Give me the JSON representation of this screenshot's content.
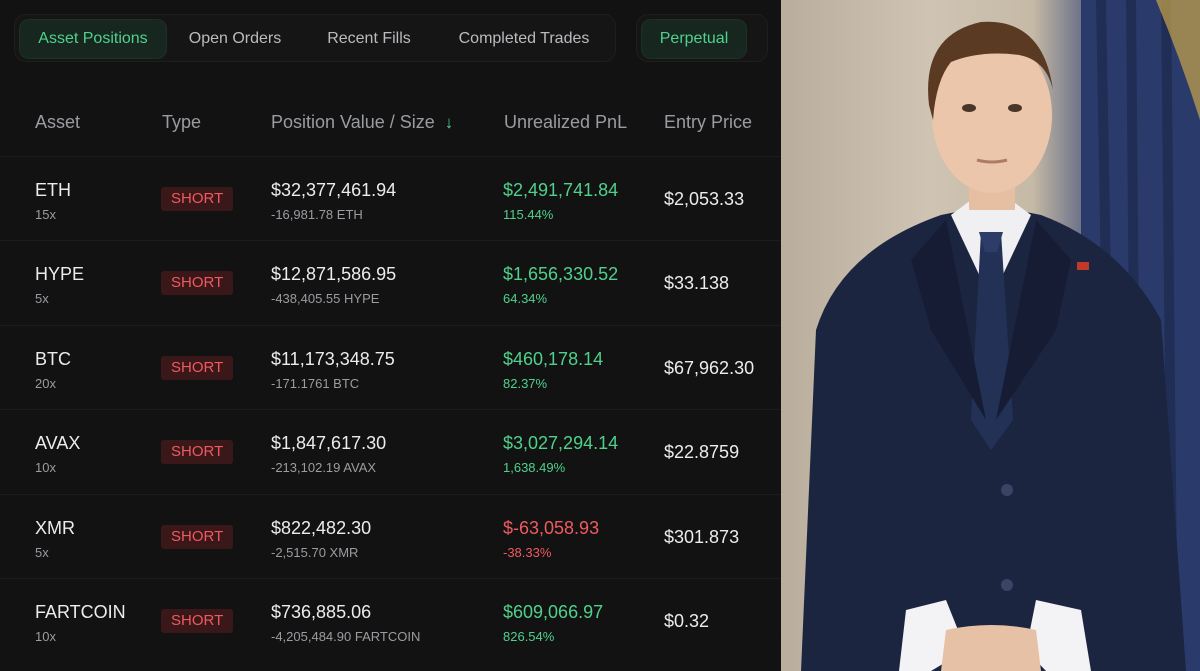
{
  "tabs": [
    {
      "label": "Asset Positions",
      "active": true
    },
    {
      "label": "Open Orders",
      "active": false
    },
    {
      "label": "Recent Fills",
      "active": false
    },
    {
      "label": "Completed Trades",
      "active": false
    }
  ],
  "market_toggle": {
    "label": "Perpetual",
    "active": true
  },
  "table": {
    "headers": {
      "asset": "Asset",
      "type": "Type",
      "position": "Position Value / Size",
      "pnl": "Unrealized PnL",
      "entry": "Entry Price"
    },
    "sort_icon": "arrow-down-icon",
    "rows": [
      {
        "asset": "ETH",
        "leverage": "15x",
        "type": "SHORT",
        "value": "$32,377,461.94",
        "size": "-16,981.78 ETH",
        "pnl": "$2,491,741.84",
        "pnl_pct": "115.44%",
        "pnl_sign": "pos",
        "entry": "$2,053.33"
      },
      {
        "asset": "HYPE",
        "leverage": "5x",
        "type": "SHORT",
        "value": "$12,871,586.95",
        "size": "-438,405.55 HYPE",
        "pnl": "$1,656,330.52",
        "pnl_pct": "64.34%",
        "pnl_sign": "pos",
        "entry": "$33.138"
      },
      {
        "asset": "BTC",
        "leverage": "20x",
        "type": "SHORT",
        "value": "$11,173,348.75",
        "size": "-171.1761 BTC",
        "pnl": "$460,178.14",
        "pnl_pct": "82.37%",
        "pnl_sign": "pos",
        "entry": "$67,962.30"
      },
      {
        "asset": "AVAX",
        "leverage": "10x",
        "type": "SHORT",
        "value": "$1,847,617.30",
        "size": "-213,102.19 AVAX",
        "pnl": "$3,027,294.14",
        "pnl_pct": "1,638.49%",
        "pnl_sign": "pos",
        "entry": "$22.8759"
      },
      {
        "asset": "XMR",
        "leverage": "5x",
        "type": "SHORT",
        "value": "$822,482.30",
        "size": "-2,515.70 XMR",
        "pnl": "$-63,058.93",
        "pnl_pct": "-38.33%",
        "pnl_sign": "neg",
        "entry": "$301.873"
      },
      {
        "asset": "FARTCOIN",
        "leverage": "10x",
        "type": "SHORT",
        "value": "$736,885.06",
        "size": "-4,205,484.90 FARTCOIN",
        "pnl": "$609,066.97",
        "pnl_pct": "826.54%",
        "pnl_sign": "pos",
        "entry": "$0.32"
      }
    ]
  },
  "colors": {
    "background": "#121212",
    "accent_green": "#4fd18c",
    "negative_red": "#ef5a5f",
    "short_badge_bg": "#3a1719",
    "muted_text": "#9a9ca1"
  },
  "photo": {
    "subject": "photo-of-man-in-navy-suit"
  }
}
